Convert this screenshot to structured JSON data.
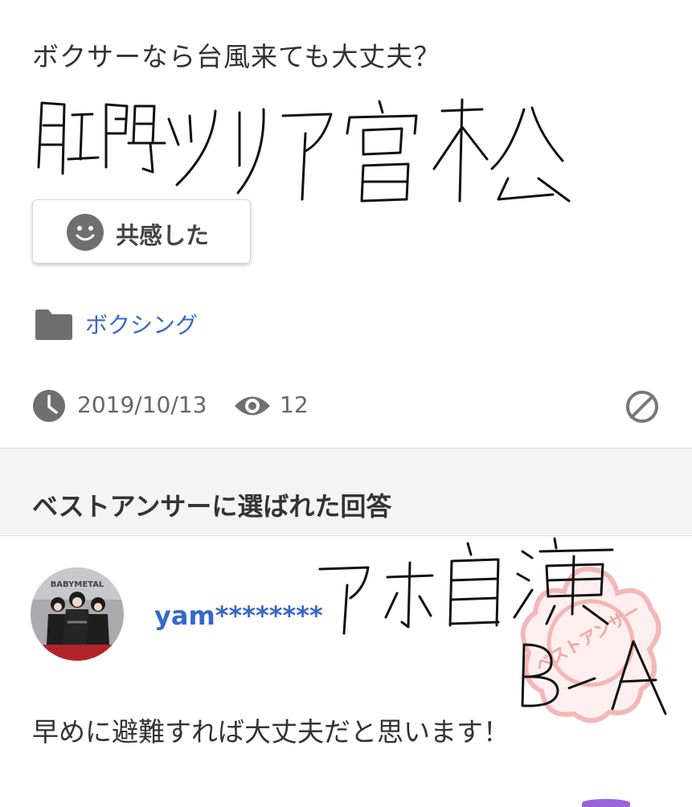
{
  "question": {
    "text": "ボクサーなら台風来ても大丈夫？",
    "handwritten_note": "肛門ツリア宮松"
  },
  "empathy": {
    "icon": "smiley-icon",
    "label": "共感した"
  },
  "category": {
    "icon": "folder-icon",
    "label": "ボクシング"
  },
  "meta": {
    "clock_icon": "clock-icon",
    "date": "2019/10/13",
    "eye_icon": "eye-icon",
    "views": "12",
    "report_icon": "block-icon"
  },
  "best_answer": {
    "section_title": "ベストアンサーに選ばれた回答",
    "username": "yam********",
    "avatar_text": "BABYMETAL",
    "answer_text": "早めに避難すれば大丈夫だと思います！",
    "stamp_text": "ベストアンサー",
    "handwritten_overlay": "アホ自演 BA"
  },
  "colors": {
    "link": "#3768c8",
    "icon_gray": "#6f6f6f",
    "stamp": "#f1a6a6"
  }
}
